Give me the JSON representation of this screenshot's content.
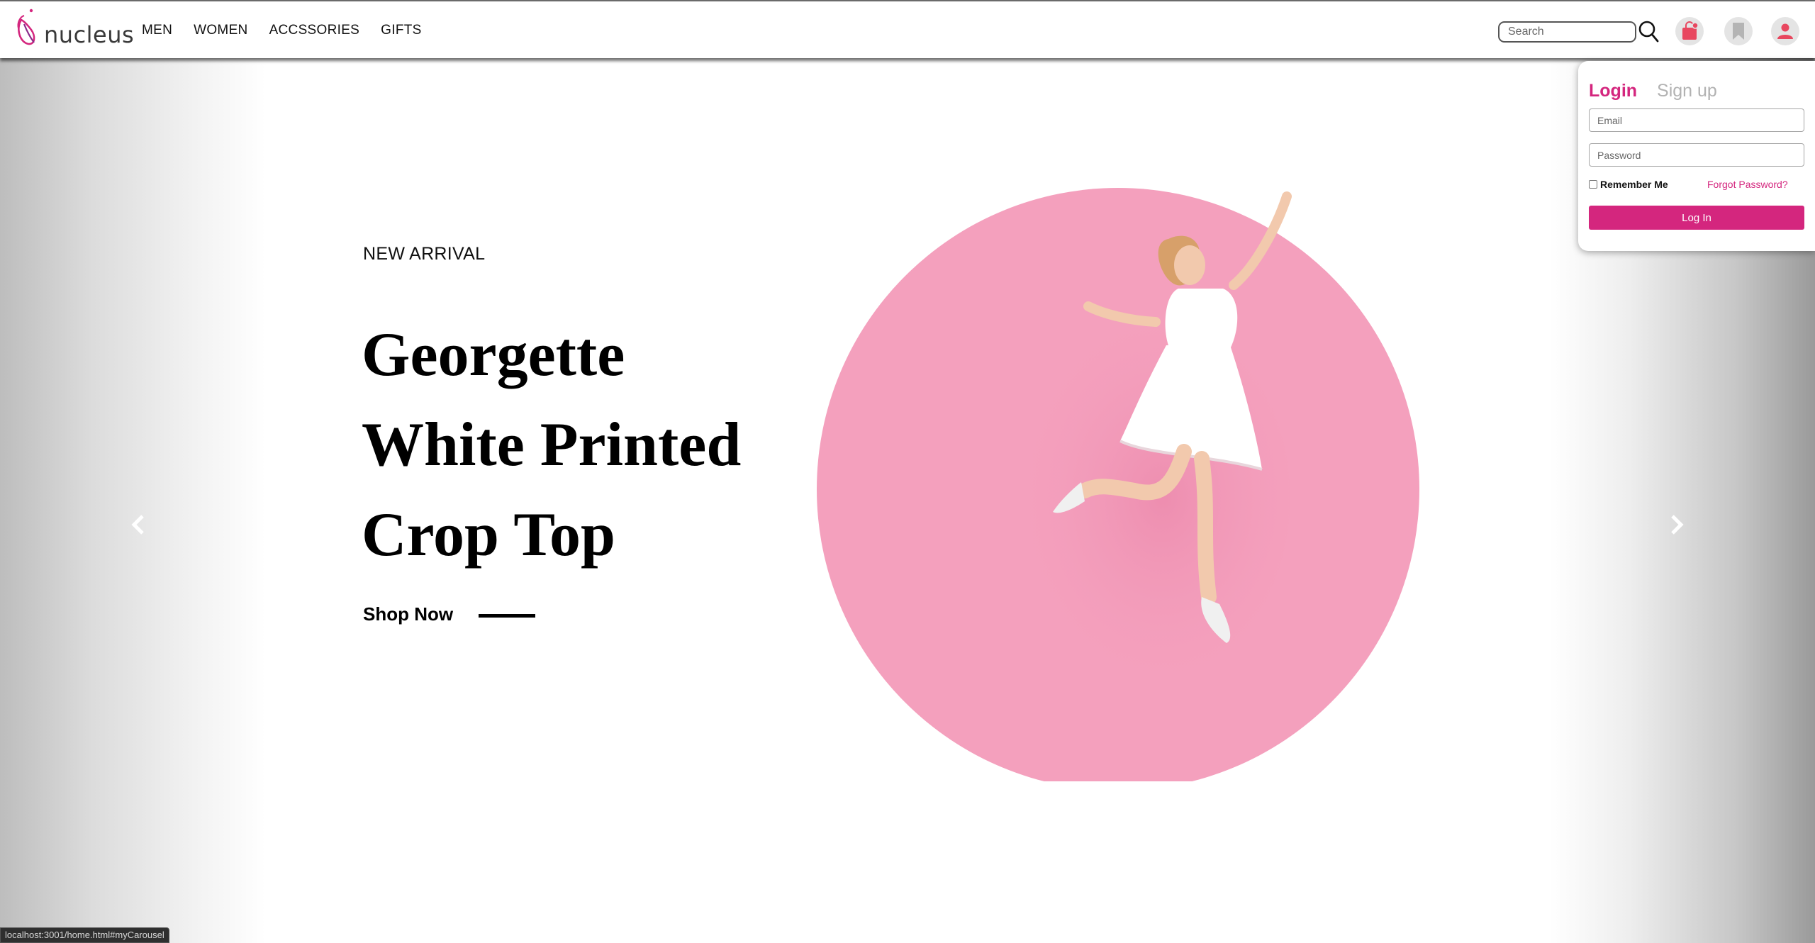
{
  "brand": {
    "name": "nucleus",
    "accent": "#d4267e"
  },
  "nav": {
    "links": [
      {
        "label": "MEN"
      },
      {
        "label": "WOMEN"
      },
      {
        "label": "ACCSSORIES"
      },
      {
        "label": "GIFTS"
      }
    ]
  },
  "search": {
    "placeholder": "Search",
    "icon": "search-icon"
  },
  "header_icons": [
    "shopping-bag-icon",
    "bookmark-icon",
    "user-icon"
  ],
  "hero": {
    "eyebrow": "NEW ARRIVAL",
    "title_lines": [
      "Georgette",
      "White Printed",
      "Crop Top"
    ],
    "cta": "Shop Now",
    "circle_color": "#f4a0bd",
    "controls": {
      "prev_icon": "chevron-left-icon",
      "next_icon": "chevron-right-icon"
    }
  },
  "login": {
    "tabs": [
      "Login",
      "Sign up"
    ],
    "active_tab": "Login",
    "email_placeholder": "Email",
    "password_placeholder": "Password",
    "remember_label": "Remember Me",
    "remember_checked": false,
    "forgot_label": "Forgot Password?",
    "submit_label": "Log In"
  },
  "status_bar": {
    "url": "localhost:3001/home.html#myCarousel"
  }
}
